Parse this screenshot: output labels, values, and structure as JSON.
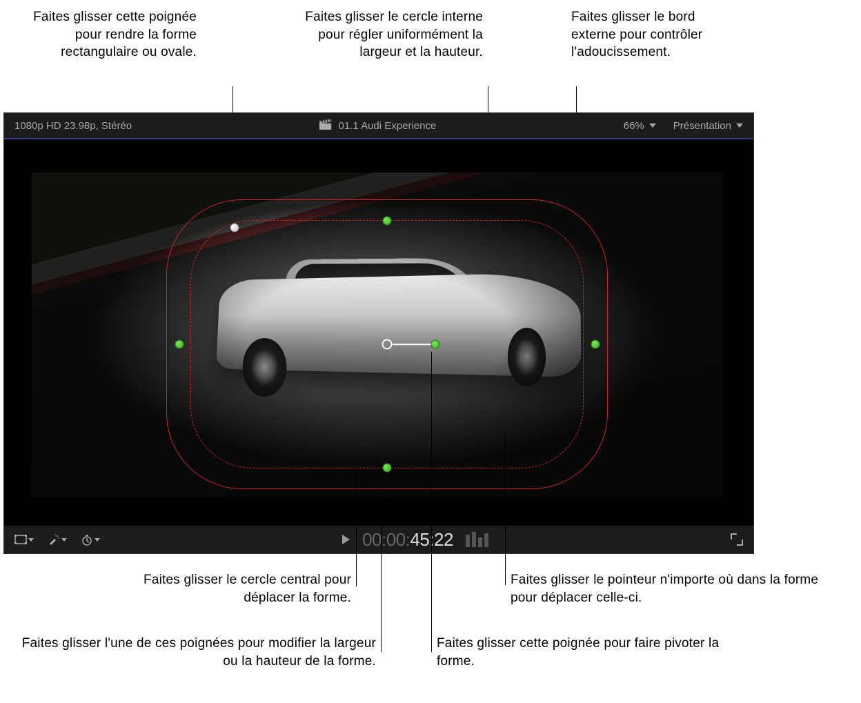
{
  "annotations": {
    "top_left": "Faites glisser cette poignée pour rendre la forme rectangulaire ou ovale.",
    "top_center": "Faites glisser le cercle interne pour régler uniformément la largeur et la hauteur.",
    "top_right": "Faites glisser le bord externe pour contrôler l'adoucissement.",
    "bottom_1": "Faites glisser le cercle central pour déplacer la forme.",
    "bottom_2": "Faites glisser l'une de ces poignées pour modifier la largeur ou la hauteur de la forme.",
    "bottom_3": "Faites glisser cette poignée pour faire pivoter la forme.",
    "bottom_4": "Faites glisser le pointeur n'importe où dans la forme pour déplacer celle-ci."
  },
  "viewer": {
    "format_info": "1080p HD 23.98p, Stéréo",
    "clip_name": "01.1 Audi Experience",
    "zoom_level": "66%",
    "view_menu": "Présentation",
    "timecode_prefix": "00:00:",
    "timecode_active": "45:22"
  },
  "colors": {
    "mask_outline": "#cc2222",
    "handle_green": "#4ac030",
    "handle_white": "#e8e8e8"
  }
}
